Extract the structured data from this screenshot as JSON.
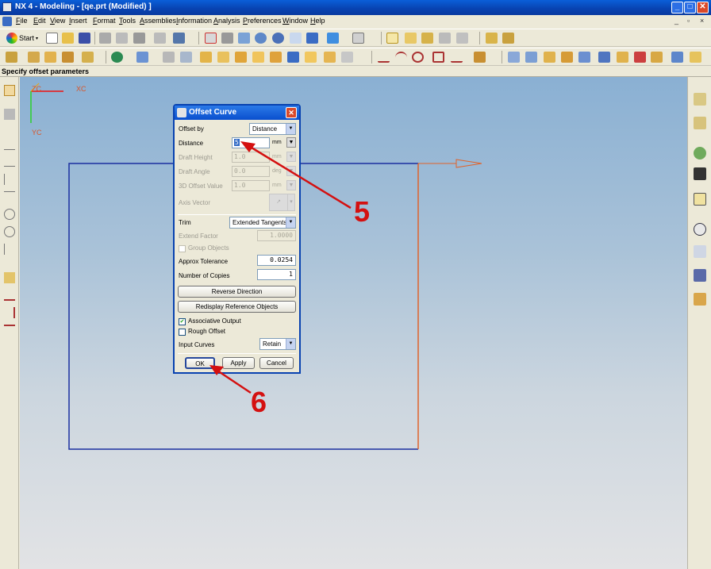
{
  "window": {
    "title": "NX 4 - Modeling - [qe.prt (Modified) ]",
    "minimize": "_",
    "maximize": "□",
    "close": "✕"
  },
  "menubar": {
    "items": [
      "File",
      "Edit",
      "View",
      "Insert",
      "Format",
      "Tools",
      "Assemblies",
      "Information",
      "Analysis",
      "Preferences",
      "Window",
      "Help"
    ],
    "mdi_minimize": "_",
    "mdi_restore": "▫",
    "mdi_close": "×"
  },
  "toolbar": {
    "start_label": "Start"
  },
  "status": {
    "prompt": "Specify offset parameters"
  },
  "viewport": {
    "axis_zc": "ZC",
    "axis_xc": "XC",
    "axis_yc": "YC"
  },
  "dialog": {
    "title": "Offset Curve",
    "offset_by_label": "Offset by",
    "offset_by_value": "Distance",
    "distance_label": "Distance",
    "distance_value": "5",
    "distance_unit": "mm",
    "draft_height_label": "Draft Height",
    "draft_height_value": "1.0",
    "draft_height_unit": "mm",
    "draft_angle_label": "Draft Angle",
    "draft_angle_value": "0.0",
    "draft_angle_unit": "deg",
    "offset_3d_label": "3D Offset Value",
    "offset_3d_value": "1.0",
    "offset_3d_unit": "mm",
    "axis_vector_label": "Axis Vector",
    "trim_label": "Trim",
    "trim_value": "Extended Tangents",
    "extend_factor_label": "Extend Factor",
    "extend_factor_value": "1.0000",
    "group_objects_label": "Group Objects",
    "approx_tolerance_label": "Approx Tolerance",
    "approx_tolerance_value": "0.0254",
    "copies_label": "Number of Copies",
    "copies_value": "1",
    "reverse_button": "Reverse Direction",
    "redisplay_button": "Redisplay Reference Objects",
    "associative_label": "Associative Output",
    "associative_checked": true,
    "rough_offset_label": "Rough Offset",
    "rough_offset_checked": false,
    "input_curves_label": "Input Curves",
    "input_curves_value": "Retain",
    "ok_button": "OK",
    "apply_button": "Apply",
    "cancel_button": "Cancel"
  },
  "annotations": {
    "step5": "5",
    "step6": "6",
    "color": "#d41010"
  },
  "colors": {
    "titlebar": "#0842b0",
    "curve_blue": "#1a2fa0",
    "curve_orange": "#e0622a"
  }
}
